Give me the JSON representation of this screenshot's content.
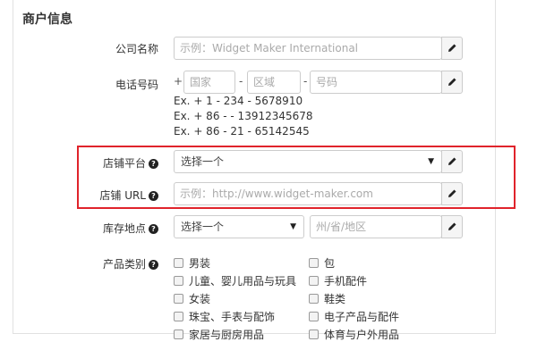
{
  "section_title": "商户信息",
  "company": {
    "label": "公司名称",
    "placeholder": "示例：Widget Maker International"
  },
  "phone": {
    "label": "电话号码",
    "plus": "+",
    "country_placeholder": "国家",
    "dash1": "-",
    "area_placeholder": "区域",
    "dash2": "-",
    "number_placeholder": "号码",
    "examples": [
      "Ex. + 1 - 234 - 5678910",
      "Ex. + 86 - - 13912345678",
      "Ex. + 86 - 21 - 65142545"
    ]
  },
  "store_platform": {
    "label": "店铺平台",
    "selected": "选择一个"
  },
  "store_url": {
    "label": "店铺 URL",
    "placeholder": "示例：http://www.widget-maker.com"
  },
  "inventory": {
    "label": "库存地点",
    "selected": "选择一个",
    "region_placeholder": "州/省/地区"
  },
  "categories": {
    "label": "产品类别",
    "left": [
      "男装",
      "儿童、婴儿用品与玩具",
      "女装",
      "珠宝、手表与配饰",
      "家居与厨房用品"
    ],
    "right": [
      "包",
      "手机配件",
      "鞋类",
      "电子产品与配件",
      "体育与户外用品"
    ]
  },
  "icons": {
    "help": "question-circle-icon",
    "edit": "pencil-icon",
    "caret": "caret-down-icon"
  },
  "colors": {
    "highlight": "#e0232b"
  }
}
